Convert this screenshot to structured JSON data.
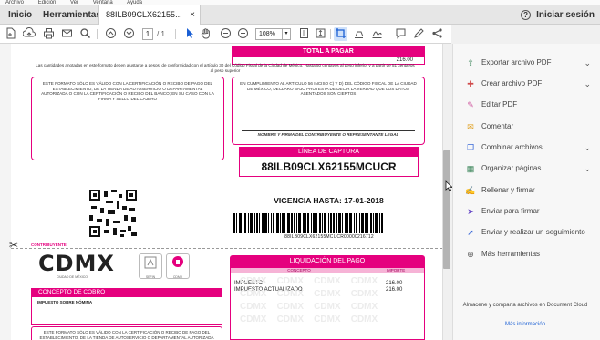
{
  "menubar": {
    "items": [
      "Archivo",
      "Edición",
      "Ver",
      "Ventana",
      "Ayuda"
    ]
  },
  "tabs": {
    "home": "Inicio",
    "tools": "Herramientas",
    "document": "88ILB09CLX62155...",
    "close": "×"
  },
  "header": {
    "help_icon": "?",
    "signin": "Iniciar sesión"
  },
  "toolbar": {
    "page_current": "1",
    "page_total": "/ 1",
    "zoom": "108%"
  },
  "document": {
    "total_label": "TOTAL A PAGAR",
    "total_value": "216.00",
    "legal_top": "Las cantidades anotadas en este formato deben ajustarse a pesos; de conformidad con el artículo 30 del Código Fiscal de la Ciudad de México. Hasta 50 centavos al peso inferior y a partir de 51 centavos al peso superior",
    "box_left": "ESTE FORMATO SÓLO ES VÁLIDO CON LA CERTIFICACIÓN O RECIBO DE PAGO DEL ESTABLECIMIENTO, DE LA TIENDA DE AUTOSERVICIO O DEPARTAMENTAL AUTORIZADA O CON LA CERTIFICACIÓN O RECIBO DEL BANCO; EN SU CASO CON LA FIRMA Y SELLO DEL CAJERO",
    "box_right": "EN CUMPLIMIENTO AL ARTÍCULO 56 INCISO C) Y D) DEL CÓDIGO FISCAL DE LA CIUDAD DE MÉXICO, DECLARO BAJO PROTESTA DE DECIR LA VERDAD QUE LOS DATOS ASENTADOS SON CIERTOS",
    "signature_label": "NOMBRE Y FIRMA DEL CONTRIBUYENTE O REPRESENTANTE LEGAL",
    "capture_label": "LÍNEA DE CAPTURA",
    "capture_code": "88ILB09CLX62155MCUCR",
    "vigencia": "VIGENCIA HASTA: 17-01-2018",
    "barcode_text": "88ILB09CLX62155MCUCR00000216712",
    "contribuyente_label": "CONTRIBUYENTE",
    "cdmx": "CDMX",
    "cdmx_sub": "CIUDAD DE MÉXICO",
    "logo1_caption": "SEFIN",
    "logo2_caption": "CDMX",
    "liquidacion_label": "LIQUIDACIÓN DEL PAGO",
    "col_concepto": "CONCEPTO",
    "col_importe": "IMPORTE",
    "concepto_label": "CONCEPTO DE COBRO",
    "concepto_text": "IMPUESTO SOBRE NÓMINA",
    "rows": [
      {
        "concept": "IMPUESTO",
        "amount": "216.00"
      },
      {
        "concept": "IMPUESTO ACTUALIZADO",
        "amount": "216.00"
      }
    ],
    "bottom_text": "ESTE FORMATO SÓLO ES VÁLIDO CON LA CERTIFICACIÓN O RECIBO DE PAGO DEL ESTABLECIMIENTO, DE LA TIENDA DE AUTOSERVICIO O DEPARTAMENTAL AUTORIZADA",
    "watermark": "CDMX"
  },
  "right_panel": {
    "items": [
      {
        "label": "Exportar archivo PDF",
        "icon": "export-pdf-icon",
        "color": "#2e7d4f",
        "chevron": true
      },
      {
        "label": "Crear archivo PDF",
        "icon": "create-pdf-icon",
        "color": "#d04a4a",
        "chevron": true
      },
      {
        "label": "Editar PDF",
        "icon": "edit-pdf-icon",
        "color": "#d05aa0",
        "chevron": false
      },
      {
        "label": "Comentar",
        "icon": "comment-icon",
        "color": "#e0a020",
        "chevron": false
      },
      {
        "label": "Combinar archivos",
        "icon": "combine-icon",
        "color": "#3b6ad8",
        "chevron": true
      },
      {
        "label": "Organizar páginas",
        "icon": "organize-icon",
        "color": "#2e7d4f",
        "chevron": true
      },
      {
        "label": "Rellenar y firmar",
        "icon": "fill-sign-icon",
        "color": "#6b4fc8",
        "chevron": false
      },
      {
        "label": "Enviar para firmar",
        "icon": "send-sign-icon",
        "color": "#6b4fc8",
        "chevron": false
      },
      {
        "label": "Enviar y realizar un seguimiento",
        "icon": "send-track-icon",
        "color": "#3b6ad8",
        "chevron": false
      },
      {
        "label": "Más herramientas",
        "icon": "more-tools-icon",
        "color": "#555555",
        "chevron": false
      }
    ],
    "cloud_text": "Almacene y comparta archivos en Document Cloud",
    "cloud_link": "Más información"
  },
  "colors": {
    "accent": "#e5007e",
    "link": "#1a5fd4"
  }
}
